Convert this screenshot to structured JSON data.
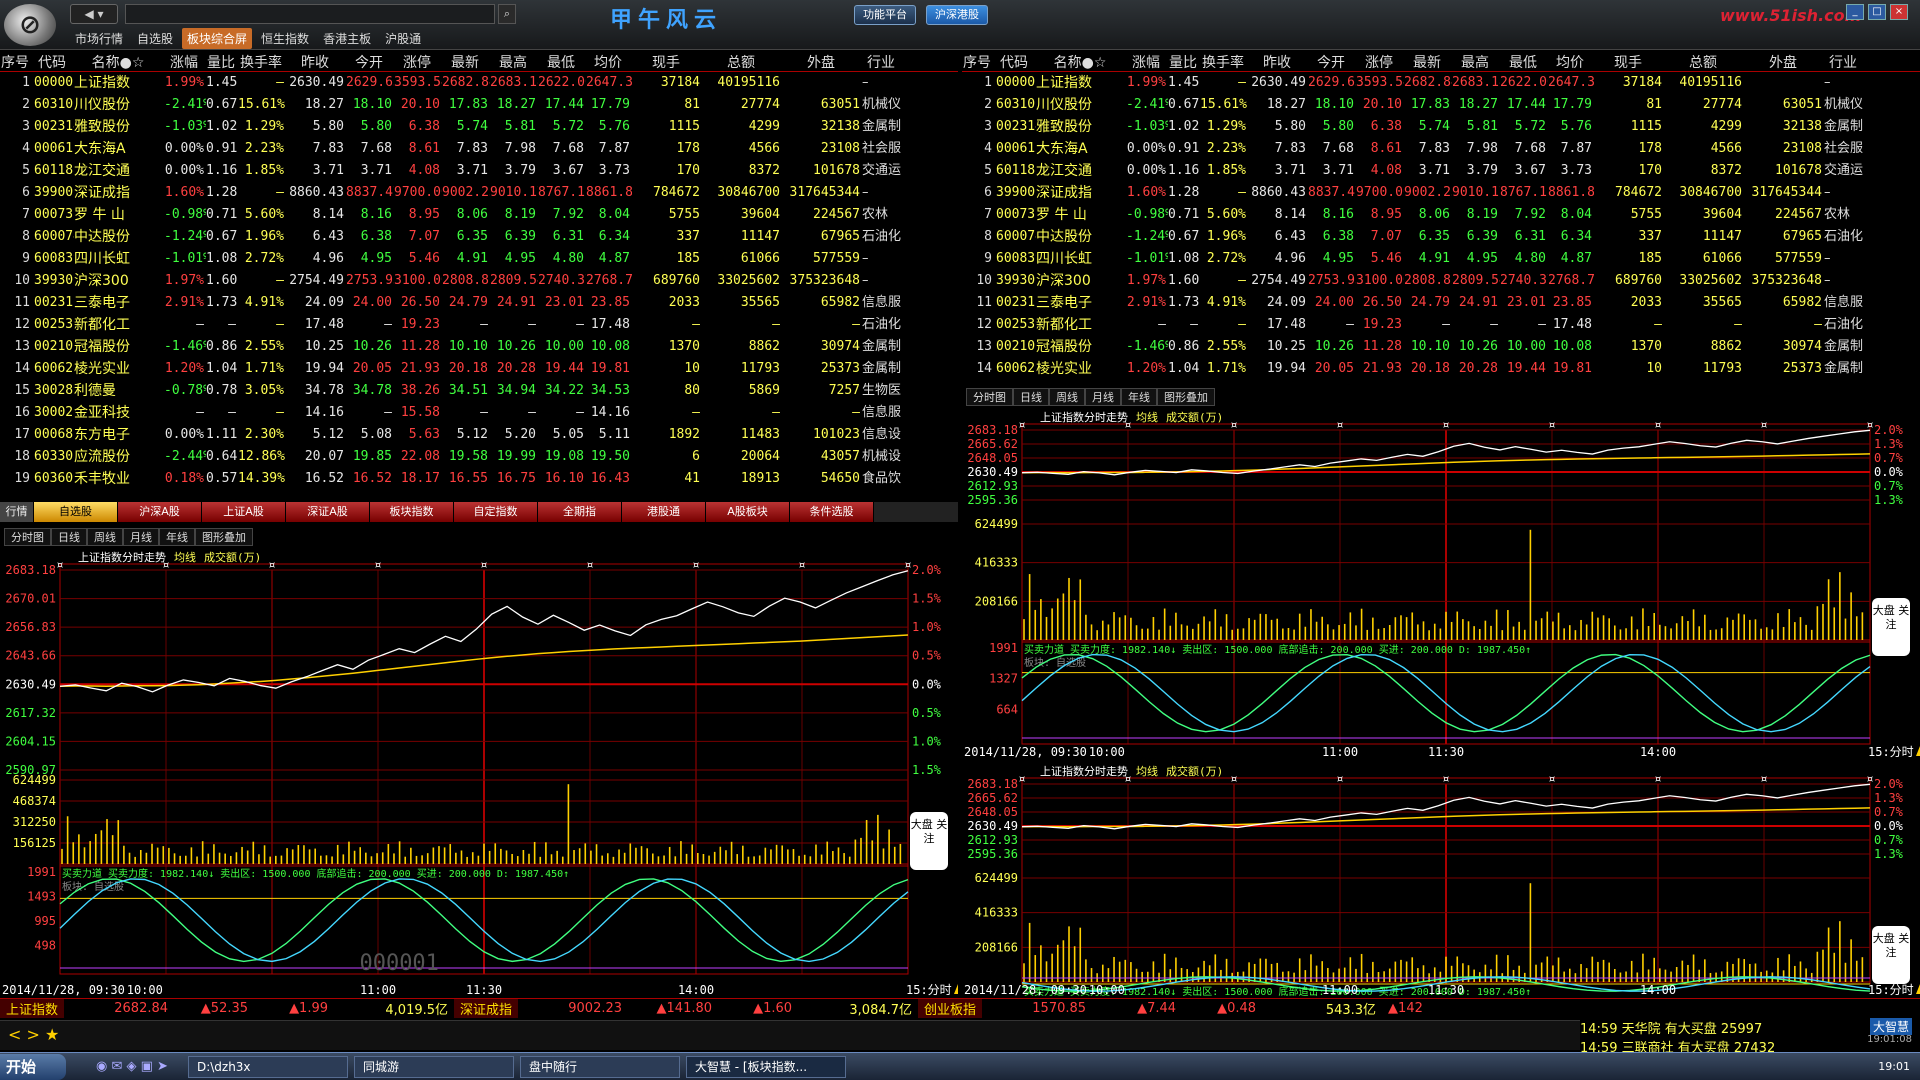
{
  "top": {
    "nav": "◀ ▾",
    "search_placeholder": "",
    "menu": [
      "市场行情",
      "自选股",
      "板块综合屏",
      "恒生指数",
      "香港主板",
      "沪股通"
    ],
    "brand": "甲午风云",
    "platform": "功能平台",
    "hushen": "沪深港股",
    "watermark": "www.51ish.com"
  },
  "columns": [
    "序号",
    "代码",
    "名称●☆",
    "涨幅",
    "量比",
    "换手率",
    "昨收",
    "今开",
    "涨停",
    "最新",
    "最高",
    "最低",
    "均价",
    "现手",
    "总额",
    "外盘",
    "行业"
  ],
  "rows": [
    {
      "seq": "1",
      "code": "000001",
      "name": "上证指数",
      "chg": "1.99%",
      "vr": "1.45",
      "to": "–",
      "pc": "2630.49",
      "op": "2629.63",
      "lu": "3593.54",
      "last": "2682.84",
      "hi": "2683.18",
      "lo": "2622.06",
      "avg": "2647.36",
      "vol": "37184",
      "amt": "40195116",
      "ext": "",
      "ind": "–",
      "dir": "up"
    },
    {
      "seq": "2",
      "code": "603100",
      "name": "川仪股份",
      "chg": "-2.41%",
      "vr": "0.67",
      "to": "15.61%",
      "pc": "18.27",
      "op": "18.10",
      "lu": "20.10",
      "last": "17.83",
      "hi": "18.27",
      "lo": "17.44",
      "avg": "17.79",
      "vol": "81",
      "amt": "27774",
      "ext": "63051",
      "ind": "机械仪",
      "dir": "dn"
    },
    {
      "seq": "3",
      "code": "002314",
      "name": "雅致股份",
      "chg": "-1.03%",
      "vr": "1.02",
      "to": "1.29%",
      "pc": "5.80",
      "op": "5.80",
      "lu": "6.38",
      "last": "5.74",
      "hi": "5.81",
      "lo": "5.72",
      "avg": "5.76",
      "vol": "1115",
      "amt": "4299",
      "ext": "32138",
      "ind": "金属制",
      "dir": "dn"
    },
    {
      "seq": "4",
      "code": "000613",
      "name": "大东海A",
      "chg": "0.00%",
      "vr": "0.91",
      "to": "2.23%",
      "pc": "7.83",
      "op": "7.68",
      "lu": "8.61",
      "last": "7.83",
      "hi": "7.98",
      "lo": "7.68",
      "avg": "7.87",
      "vol": "178",
      "amt": "4566",
      "ext": "23108",
      "ind": "社会服",
      "dir": "wh"
    },
    {
      "seq": "5",
      "code": "601188",
      "name": "龙江交通",
      "chg": "0.00%",
      "vr": "1.16",
      "to": "1.85%",
      "pc": "3.71",
      "op": "3.71",
      "lu": "4.08",
      "last": "3.71",
      "hi": "3.79",
      "lo": "3.67",
      "avg": "3.73",
      "vol": "170",
      "amt": "8372",
      "ext": "101678",
      "ind": "交通运",
      "dir": "wh"
    },
    {
      "seq": "6",
      "code": "399001",
      "name": "深证成指",
      "chg": "1.60%",
      "vr": "1.28",
      "to": "–",
      "pc": "8860.43",
      "op": "8837.47",
      "lu": "9700.00",
      "last": "9002.23",
      "hi": "9010.17",
      "lo": "8767.12",
      "avg": "8861.80",
      "vol": "784672",
      "amt": "30846700",
      "ext": "317645344",
      "ind": "–",
      "dir": "up"
    },
    {
      "seq": "7",
      "code": "000735",
      "name": "罗 牛 山",
      "chg": "-0.98%",
      "vr": "0.71",
      "to": "5.60%",
      "pc": "8.14",
      "op": "8.16",
      "lu": "8.95",
      "last": "8.06",
      "hi": "8.19",
      "lo": "7.92",
      "avg": "8.04",
      "vol": "5755",
      "amt": "39604",
      "ext": "224567",
      "ind": "农林",
      "dir": "dn"
    },
    {
      "seq": "8",
      "code": "600074",
      "name": "中达股份",
      "chg": "-1.24%",
      "vr": "0.67",
      "to": "1.96%",
      "pc": "6.43",
      "op": "6.38",
      "lu": "7.07",
      "last": "6.35",
      "hi": "6.39",
      "lo": "6.31",
      "avg": "6.34",
      "vol": "337",
      "amt": "11147",
      "ext": "67965",
      "ind": "石油化",
      "dir": "dn"
    },
    {
      "seq": "9",
      "code": "600839",
      "name": "四川长虹",
      "chg": "-1.01%",
      "vr": "1.08",
      "to": "2.72%",
      "pc": "4.96",
      "op": "4.95",
      "lu": "5.46",
      "last": "4.91",
      "hi": "4.95",
      "lo": "4.80",
      "avg": "4.87",
      "vol": "185",
      "amt": "61066",
      "ext": "577559",
      "ind": "–",
      "dir": "dn"
    },
    {
      "seq": "10",
      "code": "399300",
      "name": "沪深300",
      "chg": "1.97%",
      "vr": "1.60",
      "to": "–",
      "pc": "2754.49",
      "op": "2753.93",
      "lu": "3100.00",
      "last": "2808.82",
      "hi": "2809.54",
      "lo": "2740.37",
      "avg": "2768.75",
      "vol": "689760",
      "amt": "33025602",
      "ext": "375323648",
      "ind": "–",
      "dir": "up"
    },
    {
      "seq": "11",
      "code": "002312",
      "name": "三泰电子",
      "chg": "2.91%",
      "vr": "1.73",
      "to": "4.91%",
      "pc": "24.09",
      "op": "24.00",
      "lu": "26.50",
      "last": "24.79",
      "hi": "24.91",
      "lo": "23.01",
      "avg": "23.85",
      "vol": "2033",
      "amt": "35565",
      "ext": "65982",
      "ind": "信息服",
      "dir": "up"
    },
    {
      "seq": "12",
      "code": "002539",
      "name": "新都化工",
      "chg": "–",
      "vr": "–",
      "to": "–",
      "pc": "17.48",
      "op": "–",
      "lu": "19.23",
      "last": "–",
      "hi": "–",
      "lo": "–",
      "avg": "17.48",
      "vol": "–",
      "amt": "–",
      "ext": "–",
      "ind": "石油化",
      "dir": "wh"
    },
    {
      "seq": "13",
      "code": "002102",
      "name": "冠福股份",
      "chg": "-1.46%",
      "vr": "0.86",
      "to": "2.55%",
      "pc": "10.25",
      "op": "10.26",
      "lu": "11.28",
      "last": "10.10",
      "hi": "10.26",
      "lo": "10.00",
      "avg": "10.08",
      "vol": "1370",
      "amt": "8862",
      "ext": "30974",
      "ind": "金属制",
      "dir": "dn"
    },
    {
      "seq": "14",
      "code": "600629",
      "name": "棱光实业",
      "chg": "1.20%",
      "vr": "1.04",
      "to": "1.71%",
      "pc": "19.94",
      "op": "20.05",
      "lu": "21.93",
      "last": "20.18",
      "hi": "20.28",
      "lo": "19.44",
      "avg": "19.81",
      "vol": "10",
      "amt": "11793",
      "ext": "25373",
      "ind": "金属制",
      "dir": "up"
    },
    {
      "seq": "15",
      "code": "300289",
      "name": "利德曼",
      "chg": "-0.78%",
      "vr": "0.78",
      "to": "3.05%",
      "pc": "34.78",
      "op": "34.78",
      "lu": "38.26",
      "last": "34.51",
      "hi": "34.94",
      "lo": "34.22",
      "avg": "34.53",
      "vol": "80",
      "amt": "5869",
      "ext": "7257",
      "ind": "生物医",
      "dir": "dn"
    },
    {
      "seq": "16",
      "code": "300028",
      "name": "金亚科技",
      "chg": "–",
      "vr": "–",
      "to": "–",
      "pc": "14.16",
      "op": "–",
      "lu": "15.58",
      "last": "–",
      "hi": "–",
      "lo": "–",
      "avg": "14.16",
      "vol": "–",
      "amt": "–",
      "ext": "–",
      "ind": "信息服",
      "dir": "wh"
    },
    {
      "seq": "17",
      "code": "000682",
      "name": "东方电子",
      "chg": "0.00%",
      "vr": "1.11",
      "to": "2.30%",
      "pc": "5.12",
      "op": "5.08",
      "lu": "5.63",
      "last": "5.12",
      "hi": "5.20",
      "lo": "5.05",
      "avg": "5.11",
      "vol": "1892",
      "amt": "11483",
      "ext": "101023",
      "ind": "信息设",
      "dir": "wh"
    },
    {
      "seq": "18",
      "code": "603308",
      "name": "应流股份",
      "chg": "-2.44%",
      "vr": "0.64",
      "to": "12.86%",
      "pc": "20.07",
      "op": "19.85",
      "lu": "22.08",
      "last": "19.58",
      "hi": "19.99",
      "lo": "19.08",
      "avg": "19.50",
      "vol": "6",
      "amt": "20064",
      "ext": "43057",
      "ind": "机械设",
      "dir": "dn"
    },
    {
      "seq": "19",
      "code": "603609",
      "name": "禾丰牧业",
      "chg": "0.18%",
      "vr": "0.57",
      "to": "14.39%",
      "pc": "16.52",
      "op": "16.52",
      "lu": "18.17",
      "last": "16.55",
      "hi": "16.75",
      "lo": "16.10",
      "avg": "16.43",
      "vol": "41",
      "amt": "18913",
      "ext": "54650",
      "ind": "食品饮",
      "dir": "up"
    }
  ],
  "tabs": {
    "label": "行情",
    "items": [
      "自选股",
      "沪深A股",
      "上证A股",
      "深证A股",
      "板块指数",
      "自定指数",
      "全期指",
      "港股通",
      "A股板块",
      "条件选股"
    ]
  },
  "subtabs": [
    "分时图",
    "日线",
    "周线",
    "月线",
    "年线",
    "图形叠加"
  ],
  "chart": {
    "title": "上证指数分时走势",
    "legend_avg": "均线",
    "legend_vol": "成交额(万)",
    "price_ticks": [
      "2683.18",
      "2670.01",
      "2656.83",
      "2643.66",
      "2630.49",
      "2617.32",
      "2604.15",
      "2590.97"
    ],
    "pct_ticks": [
      "2.0%",
      "1.5%",
      "1.0%",
      "0.5%",
      "0.0%",
      "0.5%",
      "1.0%",
      "1.5%"
    ],
    "vol_ticks": [
      "624499",
      "468374",
      "312250",
      "156125"
    ],
    "osc_ticks": [
      "1991",
      "1493",
      "995",
      "498"
    ],
    "osc_label": "买卖力道 买卖力度: 1982.140↓ 卖出区: 1500.000 底部追击: 200.000 买进: 200.000 D: 1987.450↑",
    "osc_sub": "板块: 自选股",
    "code_watermark": "000001",
    "time_labels": [
      "2014/11/28, 09:30",
      "10:00",
      "11:00",
      "11:30",
      "14:00",
      "15:分时"
    ],
    "bubble": "大盘\n关注",
    "small_price_ticks": [
      "2683.18",
      "2665.62",
      "2648.05",
      "2630.49",
      "2612.93",
      "2595.36"
    ],
    "small_pct_ticks": [
      "2.0%",
      "1.3%",
      "0.7%",
      "0.0%",
      "0.7%",
      "1.3%"
    ],
    "small_vol_ticks": [
      "624499",
      "416333",
      "208166"
    ],
    "small_osc_ticks": [
      "1991",
      "1327",
      "664"
    ],
    "price_series": [
      2629.6,
      2630.2,
      2628.8,
      2627.5,
      2631.0,
      2629.4,
      2627.0,
      2630.1,
      2632.5,
      2631.3,
      2629.8,
      2633.2,
      2631.8,
      2629.9,
      2628.7,
      2631.6,
      2634.0,
      2636.8,
      2639.5,
      2637.4,
      2641.6,
      2644.2,
      2646.9,
      2645.1,
      2649.0,
      2652.6,
      2650.2,
      2655.9,
      2662.8,
      2666.4,
      2661.5,
      2658.2,
      2662.3,
      2659.0,
      2655.4,
      2657.8,
      2655.1,
      2653.0,
      2657.9,
      2660.4,
      2662.1,
      2665.3,
      2668.4,
      2666.2,
      2663.4,
      2661.8,
      2666.5,
      2670.2,
      2668.4,
      2665.7,
      2669.2,
      2672.6,
      2675.4,
      2678.2,
      2680.9,
      2682.8
    ],
    "avg_series": [
      2629.6,
      2629.7,
      2629.7,
      2629.6,
      2629.7,
      2629.8,
      2629.8,
      2629.9,
      2630.1,
      2630.3,
      2630.6,
      2631.0,
      2631.4,
      2631.8,
      2632.3,
      2632.9,
      2633.5,
      2634.2,
      2634.9,
      2635.6,
      2636.4,
      2637.2,
      2638.0,
      2638.8,
      2639.6,
      2640.4,
      2641.2,
      2642.0,
      2642.7,
      2643.4,
      2644.0,
      2644.6,
      2645.1,
      2645.6,
      2646.0,
      2646.4,
      2646.8,
      2647.1,
      2647.4,
      2647.7,
      2648.0,
      2648.3,
      2648.6,
      2648.9,
      2649.2,
      2649.5,
      2649.8,
      2650.1,
      2650.4,
      2650.8,
      2651.2,
      2651.6,
      2652.0,
      2652.4,
      2652.8,
      2653.2
    ]
  },
  "statusbar": {
    "sh_label": "上证指数",
    "sh_val": "2682.84",
    "sh_chg": "▲52.35",
    "sh_pct": "▲1.99",
    "sh_amt": "4,019.5亿",
    "sz_label": "深证成指",
    "sz_val": "9002.23",
    "sz_chg": "▲141.80",
    "sz_pct": "▲1.60",
    "sz_amt": "3,084.7亿",
    "cy_label": "创业板指",
    "cy_val": "1570.85",
    "cy_chg": "▲7.44",
    "cy_pct": "▲0.48",
    "cy_amt": "543.3亿",
    "tail": "▲142"
  },
  "news": [
    {
      "t": "14:59",
      "txt": "天华院  有大买盘 25997"
    },
    {
      "t": "14:59",
      "txt": "三联商社  有大买盘 27432"
    }
  ],
  "news_logo": "大智慧",
  "news_time": "19:01:08",
  "toolbar2": "< > ★",
  "taskbar": {
    "start": "开始",
    "tasks": [
      "D:\\dzh3x",
      "同城游",
      "盘中随行",
      "大智慧 - [板块指数..."
    ],
    "clock": "19:01"
  }
}
